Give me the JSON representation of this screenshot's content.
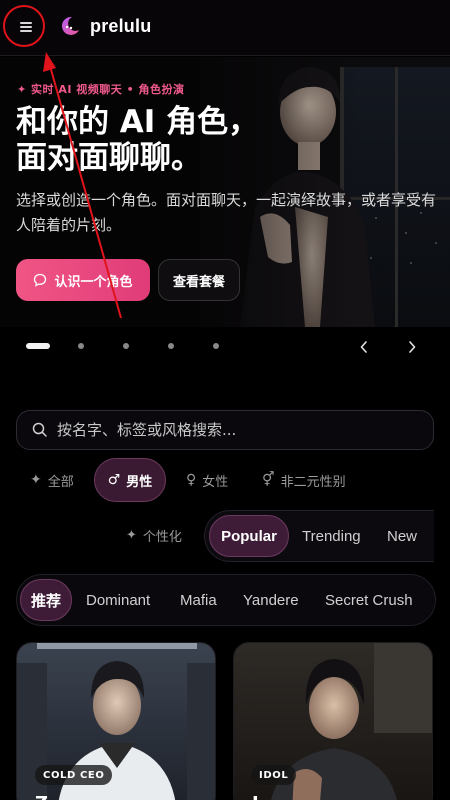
{
  "header": {
    "logo_text": "prelulu",
    "menu_icon": "hamburger-menu-icon"
  },
  "hero": {
    "eyebrow": "✦  实时 AI 视频聊天 • 角色扮演",
    "title_line1": "和你的 AI 角色，",
    "title_line2": "面对面聊聊。",
    "description": "选择或创造一个角色。面对面聊天，一起演绎故事，或者享受有人陪着的片刻。",
    "primary_button": "认识一个角色",
    "secondary_button": "查看套餐",
    "accent": "#f05585"
  },
  "carousel": {
    "slide_count": 5,
    "active_index": 0
  },
  "search": {
    "placeholder": "按名字、标签或风格搜索..."
  },
  "gender_filters": [
    {
      "label": "全部",
      "icon": "sparkle-icon",
      "symbol": "✦",
      "active": false
    },
    {
      "label": "男性",
      "icon": "male-icon",
      "symbol": "♂",
      "active": true
    },
    {
      "label": "女性",
      "icon": "female-icon",
      "symbol": "♀",
      "active": false
    },
    {
      "label": "非二元性别",
      "icon": "nonbinary-icon",
      "symbol": "⚥",
      "active": false
    }
  ],
  "sort": {
    "personalize_label": "个性化",
    "options": [
      {
        "label": "Popular",
        "active": true
      },
      {
        "label": "Trending",
        "active": false
      },
      {
        "label": "New",
        "active": false
      }
    ]
  },
  "tags": [
    {
      "label": "推荐",
      "active": true
    },
    {
      "label": "Dominant",
      "active": false
    },
    {
      "label": "Mafia",
      "active": false
    },
    {
      "label": "Yandere",
      "active": false
    },
    {
      "label": "Secret Crush",
      "active": false
    }
  ],
  "cards": [
    {
      "badge": "COLD CEO",
      "name": "Z"
    },
    {
      "badge": "IDOL",
      "name": "J"
    }
  ]
}
